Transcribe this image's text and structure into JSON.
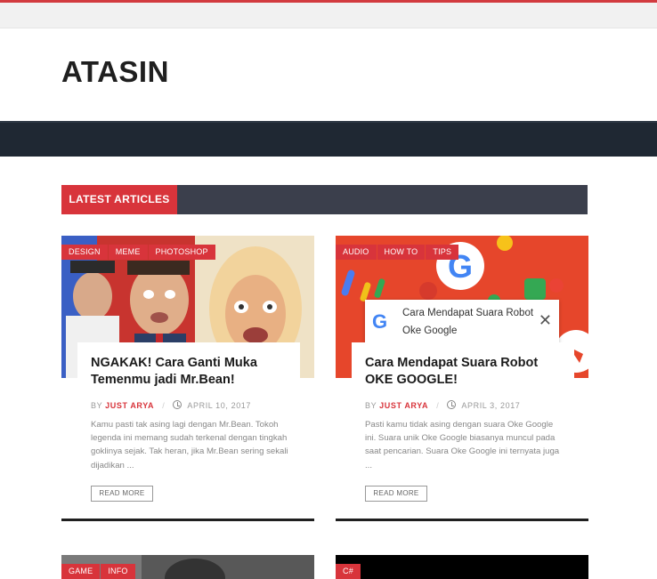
{
  "site": {
    "name": "ATASIN"
  },
  "section": {
    "label": "LATEST ARTICLES"
  },
  "articles": [
    {
      "categories": [
        "DESIGN",
        "MEME",
        "PHOTOSHOP"
      ],
      "title": "NGAKAK! Cara Ganti Muka Temenmu jadi Mr.Bean!",
      "by": "BY",
      "author": "JUST ARYA",
      "date": "APRIL 10, 2017",
      "excerpt": "Kamu pasti tak asing lagi dengan Mr.Bean. Tokoh legenda ini memang sudah terkenal dengan tingkah goklinya sejak. Tak heran, jika Mr.Bean sering sekali dijadikan ...",
      "read_more": "READ MORE"
    },
    {
      "categories": [
        "AUDIO",
        "HOW TO",
        "TIPS"
      ],
      "title": "Cara Mendapat Suara Robot OKE GOOGLE!",
      "by": "BY",
      "author": "JUST ARYA",
      "date": "APRIL 3, 2017",
      "excerpt": "Pasti kamu tidak asing dengan suara Oke Google ini. Suara unik Oke Google biasanya muncul pada saat pencarian. Suara Oke Google ini ternyata juga ...",
      "read_more": "READ MORE",
      "image_popup": {
        "text_line1": "Cara Mendapat Suara Robot",
        "text_line2": "Oke Google",
        "logo": "G"
      }
    }
  ],
  "bottom_articles": [
    {
      "categories": [
        "GAME",
        "INFO"
      ]
    },
    {
      "categories": [
        "C#"
      ]
    }
  ],
  "colors": {
    "accent": "#d8343b",
    "nav": "#1f2833",
    "section_bar": "#3b3f4c"
  }
}
